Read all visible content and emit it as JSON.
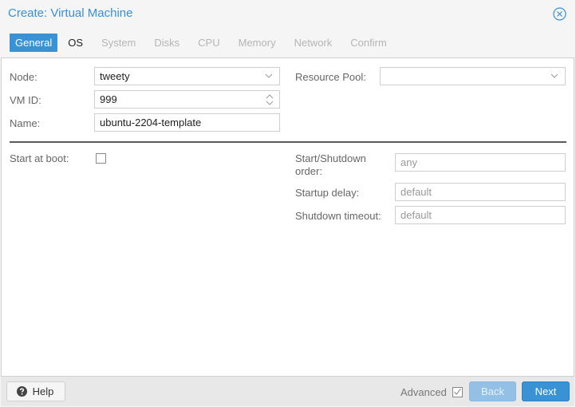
{
  "window": {
    "title": "Create: Virtual Machine",
    "close_icon": "close-circle-icon"
  },
  "tabs": [
    {
      "label": "General",
      "state": "active"
    },
    {
      "label": "OS",
      "state": "enabled"
    },
    {
      "label": "System",
      "state": "disabled"
    },
    {
      "label": "Disks",
      "state": "disabled"
    },
    {
      "label": "CPU",
      "state": "disabled"
    },
    {
      "label": "Memory",
      "state": "disabled"
    },
    {
      "label": "Network",
      "state": "disabled"
    },
    {
      "label": "Confirm",
      "state": "disabled"
    }
  ],
  "form": {
    "node": {
      "label": "Node:",
      "value": "tweety"
    },
    "vmid": {
      "label": "VM ID:",
      "value": "999"
    },
    "name": {
      "label": "Name:",
      "value": "ubuntu-2204-template"
    },
    "resource_pool": {
      "label": "Resource Pool:",
      "value": ""
    },
    "start_at_boot": {
      "label": "Start at boot:",
      "checked": false
    },
    "start_shutdown_order": {
      "label_line1": "Start/Shutdown",
      "label_line2": "order:",
      "placeholder": "any"
    },
    "startup_delay": {
      "label": "Startup delay:",
      "placeholder": "default"
    },
    "shutdown_timeout": {
      "label": "Shutdown timeout:",
      "placeholder": "default"
    }
  },
  "footer": {
    "help_label": "Help",
    "advanced_label": "Advanced",
    "advanced_checked": true,
    "back_label": "Back",
    "next_label": "Next"
  },
  "colors": {
    "accent": "#3892d4",
    "title": "#3a8fd6",
    "disabled_button": "#93c0e4"
  }
}
